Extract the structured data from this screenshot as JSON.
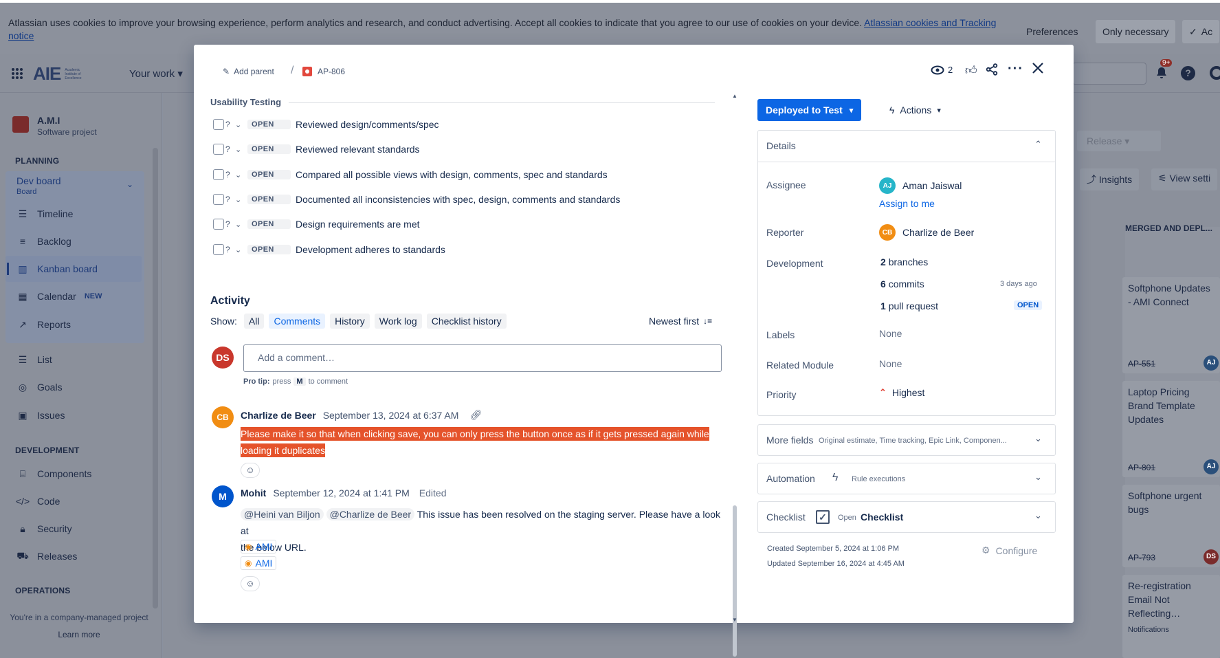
{
  "cookie": {
    "text": "Atlassian uses cookies to improve your browsing experience, perform analytics and research, and conduct advertising. Accept all cookies to indicate that you agree to our use of cookies on your device.",
    "link": "Atlassian cookies and Tracking notice",
    "prefs": "Preferences",
    "only": "Only necessary",
    "accept": "Ac"
  },
  "topnav": {
    "logo": "AIE",
    "logo_sub": "Academic Institute of Excellence",
    "your_work": "Your work",
    "notif_count": "9+"
  },
  "sidebar": {
    "project": "A.M.I",
    "project_type": "Software project",
    "planning": "PLANNING",
    "board": "Dev board",
    "board_sub": "Board",
    "items": [
      "Timeline",
      "Backlog",
      "Kanban board",
      "Calendar",
      "Reports"
    ],
    "new_badge": "NEW",
    "items2": [
      "List",
      "Goals",
      "Issues"
    ],
    "development": "DEVELOPMENT",
    "dev_items": [
      "Components",
      "Code",
      "Security",
      "Releases"
    ],
    "operations": "OPERATIONS",
    "footer": "You're in a company-managed project",
    "learn": "Learn more"
  },
  "board": {
    "release": "Release",
    "insights": "Insights",
    "view_settings": "View setti",
    "column": "MERGED AND DEPL...",
    "cards": [
      {
        "title": "Softphone Updates - AMI Connect",
        "key": "AP-551"
      },
      {
        "title": "Laptop Pricing Brand Template Updates",
        "key": "AP-801"
      },
      {
        "title": "Softphone urgent bugs",
        "key": "AP-793"
      },
      {
        "title": "Re-registration Email Not Reflecting…",
        "sub": "Notifications"
      }
    ],
    "avatars": [
      "AJ",
      "AJ",
      "DS"
    ]
  },
  "modal": {
    "add_parent": "Add parent",
    "sep": "/",
    "issue_key": "AP-806",
    "watch_count": "2",
    "checklist_title": "Usability Testing",
    "check_items": [
      {
        "status": "OPEN",
        "text": "Reviewed design/comments/spec"
      },
      {
        "status": "OPEN",
        "text": "Reviewed relevant standards"
      },
      {
        "status": "OPEN",
        "text": "Compared all possible views with design, comments, spec and standards"
      },
      {
        "status": "OPEN",
        "text": "Documented all inconsistencies with spec, design, comments and standards"
      },
      {
        "status": "OPEN",
        "text": "Design requirements are met"
      },
      {
        "status": "OPEN",
        "text": "Development adheres to standards"
      }
    ],
    "activity": {
      "title": "Activity",
      "show": "Show:",
      "tabs": [
        "All",
        "Comments",
        "History",
        "Work log",
        "Checklist history"
      ],
      "sort": "Newest first",
      "me": "DS",
      "placeholder": "Add a comment…",
      "pro_tip": "Pro tip:",
      "press": "press",
      "key": "M",
      "to_comment": "to comment",
      "comments": [
        {
          "initials": "CB",
          "author": "Charlize de Beer",
          "date": "September 13, 2024 at 6:37 AM",
          "line1": "Please make it so that when clicking save, you can only press the button once as if it gets pressed again while",
          "line2": "loading it duplicates"
        },
        {
          "initials": "M",
          "author": "Mohit",
          "date": "September 12, 2024 at 1:41 PM",
          "edited": "Edited",
          "mention1": "@Heini van Biljon",
          "mention2": "@Charlize de Beer",
          "text1": "This issue has been resolved on the staging server. Please have a look at",
          "text2": "the below URL.",
          "links": [
            "AMI",
            "AMI"
          ]
        }
      ]
    },
    "status": "Deployed to Test",
    "actions": "Actions",
    "details": {
      "title": "Details",
      "assignee_label": "Assignee",
      "assignee_initials": "AJ",
      "assignee": "Aman Jaiswal",
      "assign_me": "Assign to me",
      "reporter_label": "Reporter",
      "reporter_initials": "CB",
      "reporter": "Charlize de Beer",
      "dev_label": "Development",
      "branches_n": "2",
      "branches": "branches",
      "commits_n": "6",
      "commits": "commits",
      "commits_time": "3 days ago",
      "pr_n": "1",
      "pr": "pull request",
      "pr_status": "OPEN",
      "labels_label": "Labels",
      "labels": "None",
      "module_label": "Related Module",
      "module": "None",
      "priority_label": "Priority",
      "priority": "Highest"
    },
    "more_fields": "More fields",
    "more_fields_sub": "Original estimate, Time tracking, Epic Link, Componen...",
    "automation": "Automation",
    "automation_sub": "Rule executions",
    "checklist": "Checklist",
    "checklist_open": "Open",
    "checklist_link": "Checklist",
    "created": "Created September 5, 2024 at 1:06 PM",
    "updated": "Updated September 16, 2024 at 4:45 AM",
    "configure": "Configure"
  },
  "colors": {
    "accent": "#0c66e4",
    "highlight": "#e5532b",
    "priority": "#e2483d",
    "cb": "#f18d13",
    "m": "#0055cc",
    "ds": "#c9372c"
  }
}
